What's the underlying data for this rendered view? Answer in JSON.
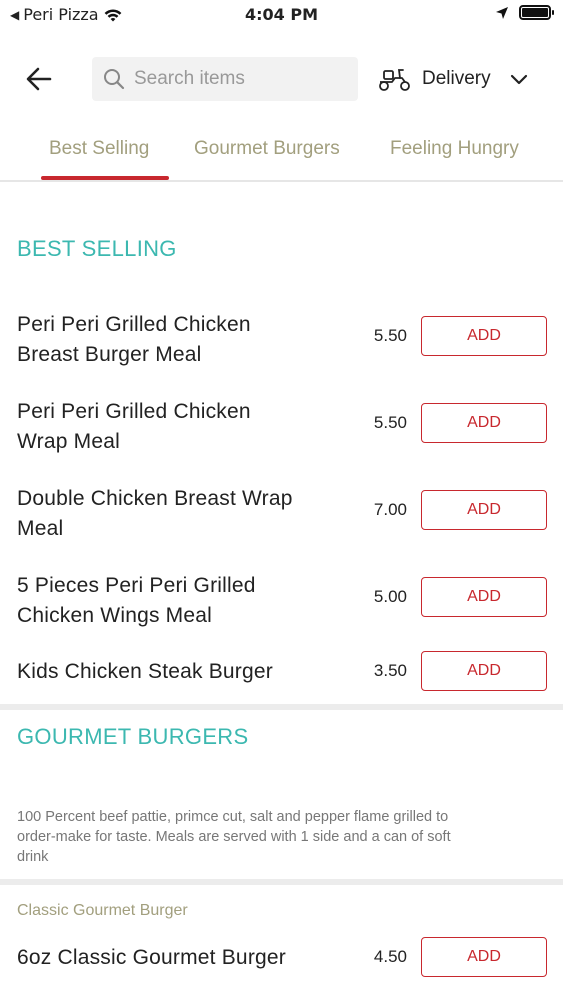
{
  "status_bar": {
    "back_app": "Peri Pizza",
    "time": "4:04 PM"
  },
  "header": {
    "search_placeholder": "Search items",
    "delivery_label": "Delivery"
  },
  "tabs": [
    {
      "label": "Best Selling",
      "active": true
    },
    {
      "label": "Gourmet Burgers",
      "active": false
    },
    {
      "label": "Feeling Hungry",
      "active": false
    }
  ],
  "colors": {
    "accent_red": "#c8282e",
    "section_teal": "#3cb8b0",
    "tab_text": "#a29f7e"
  },
  "sections": {
    "best_selling": {
      "title": "BEST SELLING",
      "items": [
        {
          "name_lines": [
            "Peri Peri Grilled Chicken",
            "Breast Burger Meal"
          ],
          "price": "5.50",
          "button": "ADD"
        },
        {
          "name_lines": [
            "Peri Peri Grilled Chicken",
            "Wrap Meal"
          ],
          "price": "5.50",
          "button": "ADD"
        },
        {
          "name_lines": [
            "Double Chicken Breast Wrap",
            "Meal"
          ],
          "price": "7.00",
          "button": "ADD"
        },
        {
          "name_lines": [
            "5 Pieces Peri Peri Grilled",
            "Chicken Wings Meal"
          ],
          "price": "5.00",
          "button": "ADD"
        },
        {
          "name_lines": [
            "Kids Chicken Steak Burger"
          ],
          "price": "3.50",
          "button": "ADD"
        }
      ]
    },
    "gourmet_burgers": {
      "title": "GOURMET BURGERS",
      "description_lines": [
        "100 Percent beef pattie, primce cut, salt and pepper flame grilled to",
        "order-make for taste. Meals are served with 1 side and a can of soft",
        "drink"
      ],
      "subsection": "Classic Gourmet Burger",
      "items": [
        {
          "name": "6oz Classic Gourmet Burger",
          "price": "4.50",
          "button": "ADD"
        }
      ]
    }
  }
}
